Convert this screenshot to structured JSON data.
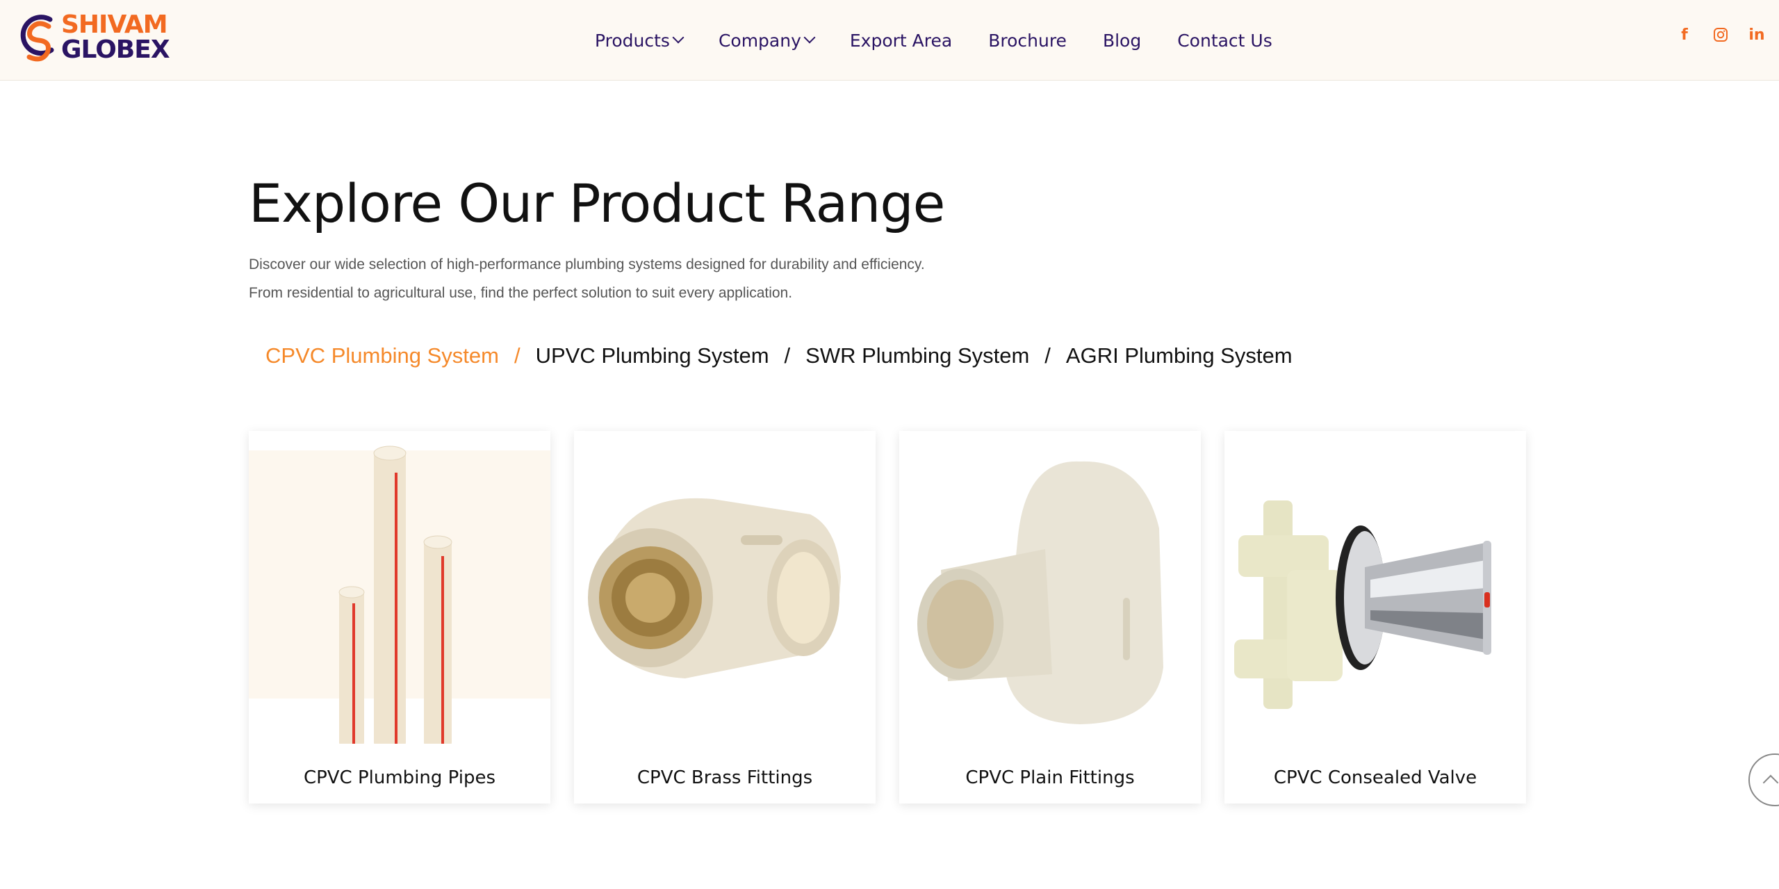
{
  "brand": {
    "logo_line1": "SHIVAM",
    "logo_line2": "GLOBEX",
    "primary_color": "#f26a21",
    "secondary_color": "#2a1463"
  },
  "nav": {
    "items": [
      {
        "label": "Products",
        "has_dropdown": true
      },
      {
        "label": "Company",
        "has_dropdown": true
      },
      {
        "label": "Export Area",
        "has_dropdown": false
      },
      {
        "label": "Brochure",
        "has_dropdown": false
      },
      {
        "label": "Blog",
        "has_dropdown": false
      },
      {
        "label": "Contact Us",
        "has_dropdown": false
      }
    ]
  },
  "social": {
    "facebook": "f",
    "instagram": "instagram-icon",
    "linkedin": "in"
  },
  "section": {
    "title": "Explore Our Product Range",
    "desc_line1": "Discover our wide selection of high-performance plumbing systems designed for durability and efficiency.",
    "desc_line2": "From residential to agricultural use, find the perfect solution to suit every application."
  },
  "tabs": [
    {
      "label": "CPVC Plumbing System",
      "active": true
    },
    {
      "label": "UPVC Plumbing System",
      "active": false
    },
    {
      "label": "SWR Plumbing System",
      "active": false
    },
    {
      "label": "AGRI Plumbing System",
      "active": false
    }
  ],
  "tab_separator": "/",
  "products": [
    {
      "label": "CPVC Plumbing Pipes",
      "icon": "pipes-image"
    },
    {
      "label": "CPVC Brass Fittings",
      "icon": "brass-elbow-image"
    },
    {
      "label": "CPVC Plain Fittings",
      "icon": "plain-elbow-image"
    },
    {
      "label": "CPVC Consealed Valve",
      "icon": "concealed-valve-image"
    }
  ],
  "colors": {
    "active_tab": "#f5892a",
    "header_bg": "#fdf9f3"
  }
}
